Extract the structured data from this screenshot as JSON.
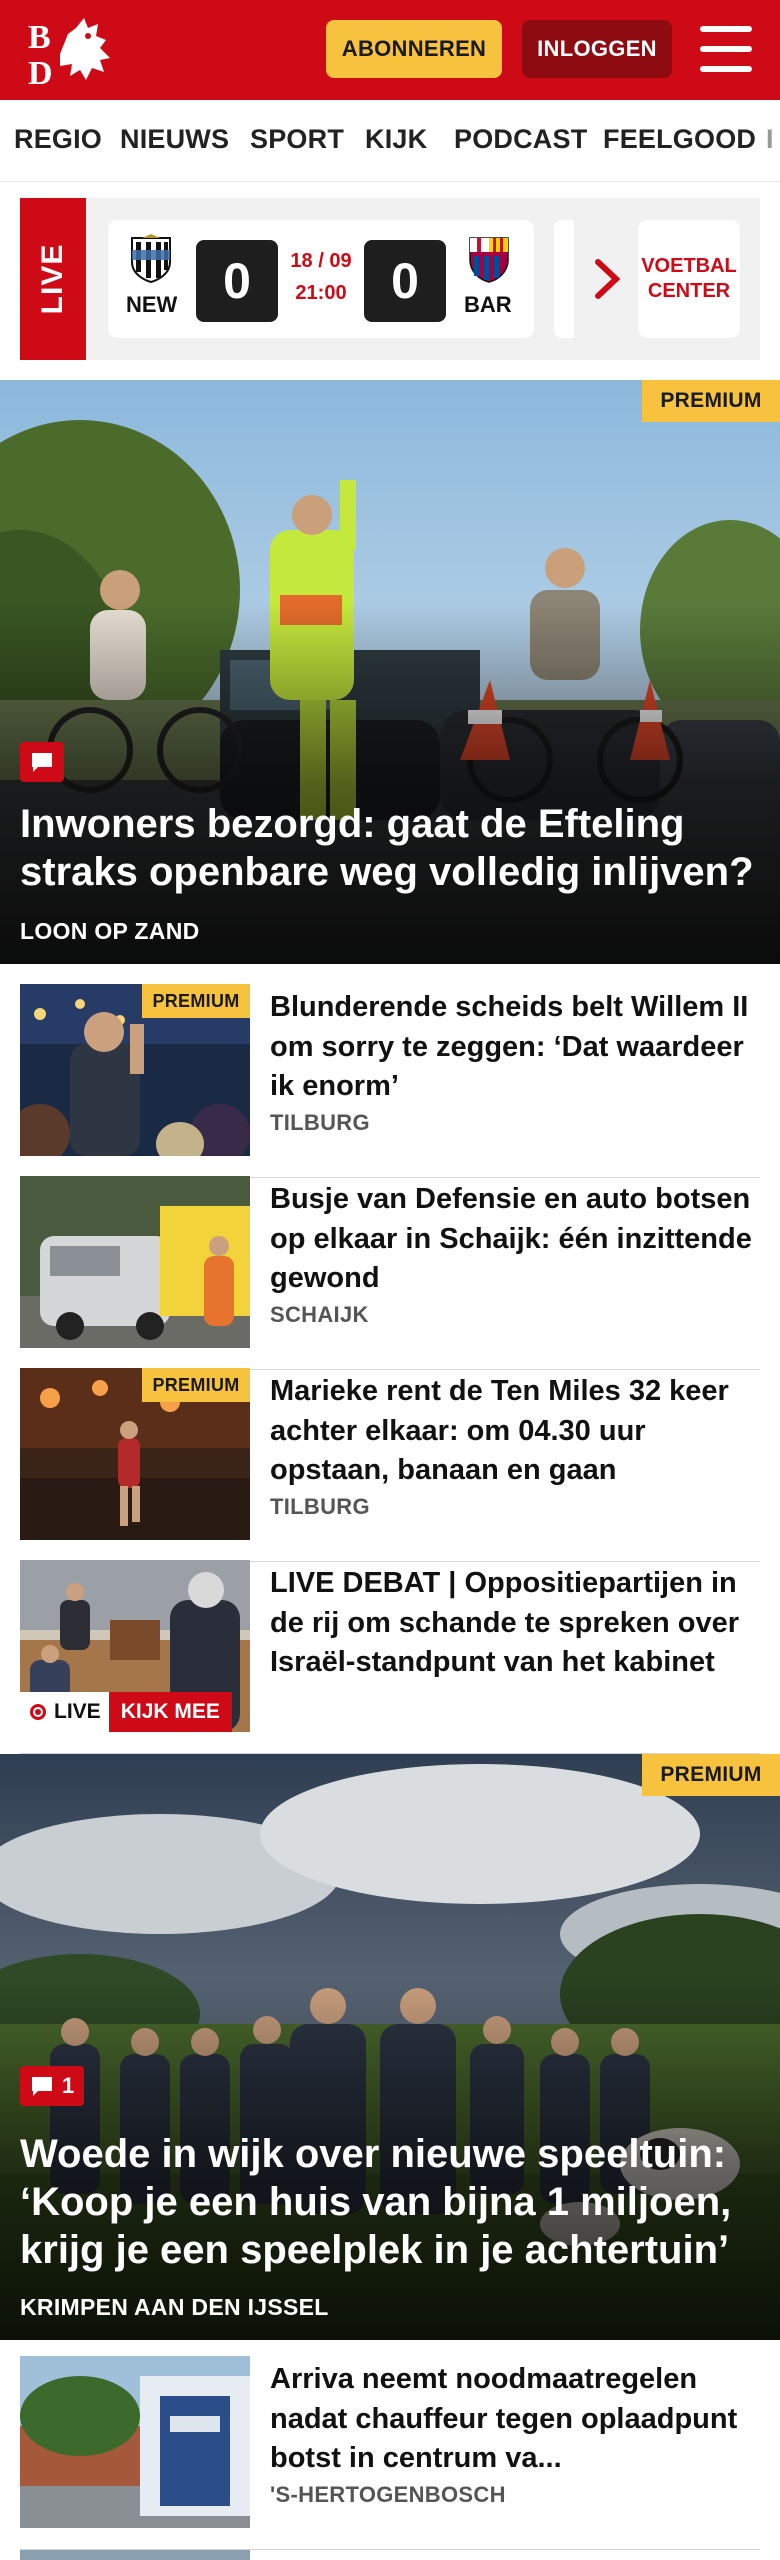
{
  "header": {
    "logo_text": "BD",
    "subscribe_label": "ABONNEREN",
    "login_label": "INLOGGEN",
    "colors": {
      "brand_red": "#cf0a17",
      "accent_yellow": "#f7c23e"
    }
  },
  "nav": {
    "items": [
      "REGIO",
      "NIEUWS",
      "SPORT",
      "KIJK",
      "PODCAST",
      "FEELGOOD",
      "I"
    ]
  },
  "live_ticker": {
    "live_label": "LIVE",
    "match": {
      "home_code": "NEW",
      "home_score": "0",
      "date": "18 / 09",
      "time": "21:00",
      "away_score": "0",
      "away_code": "BAR"
    },
    "center_label_line1": "VOETBAL",
    "center_label_line2": "CENTER"
  },
  "hero1": {
    "premium_label": "PREMIUM",
    "title": "Inwoners bezorgd: gaat de Efteling straks openbare weg volledig inlijven?",
    "location": "LOON OP ZAND",
    "comment_count": ""
  },
  "articles": [
    {
      "premium_label": "PREMIUM",
      "title": "Blunderende scheids belt Willem II om sorry te zeggen: ‘Dat waardeer ik enorm’",
      "location": "TILBURG"
    },
    {
      "title": "Busje van Defensie en auto botsen op elkaar in Schaijk: één inzittende gewond",
      "location": "SCHAIJK"
    },
    {
      "premium_label": "PREMIUM",
      "title": "Marieke rent de Ten Miles 32 keer achter elkaar: om 04.30 uur opstaan, banaan en gaan",
      "location": "TILBURG"
    },
    {
      "title": "LIVE DEBAT | Oppositiepartijen in de rij om schande te spreken over Israël-standpunt van het kabinet",
      "live_label": "LIVE",
      "watch_label": "KIJK MEE"
    }
  ],
  "hero2": {
    "premium_label": "PREMIUM",
    "title": "Woede in wijk over nieuwe speeltuin: ‘Koop je een huis van bijna 1 miljoen, krijg je een speelplek in je achtertuin’",
    "location": "KRIMPEN AAN DEN IJSSEL",
    "comment_count": "1"
  },
  "articles2": [
    {
      "title": "Arriva neemt noodmaatregelen nadat chauffeur tegen oplaadpunt botst in centrum va...",
      "location": "'S-HERTOGENBOSCH"
    }
  ]
}
